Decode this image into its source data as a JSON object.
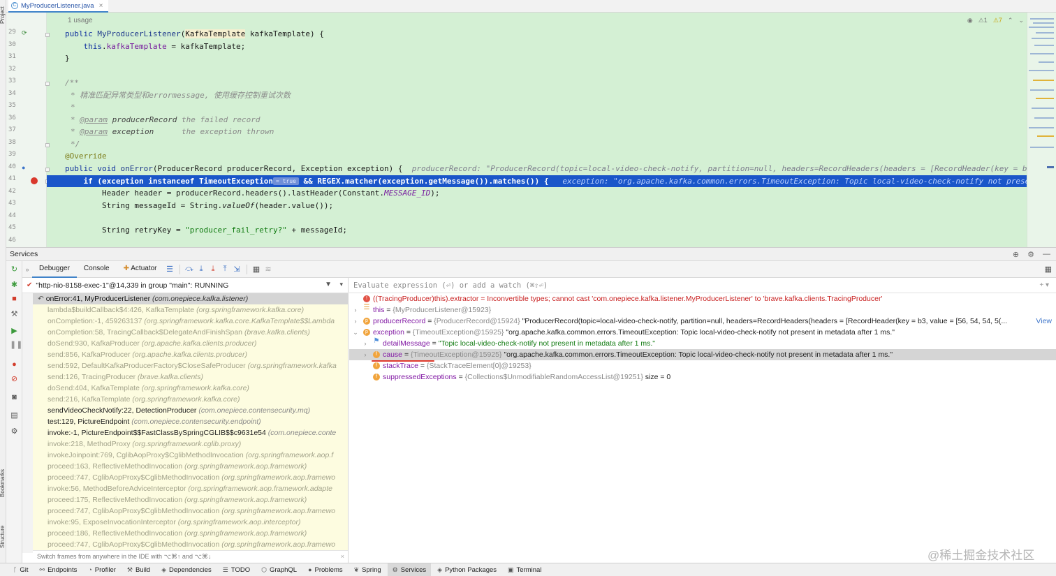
{
  "editor": {
    "tab_name": "MyProducerListener.java",
    "usage_hint": "1 usage",
    "status": {
      "warnings_a": "1",
      "warnings_b": "7"
    },
    "line_numbers": [
      "29",
      "30",
      "31",
      "32",
      "33",
      "34",
      "35",
      "36",
      "37",
      "38",
      "39",
      "40",
      "41",
      "42",
      "43",
      "44",
      "45",
      "46"
    ],
    "lines": {
      "l29": {
        "kw": "public",
        "name": "MyProducerListener",
        "paren": "(",
        "type": "KafkaTemplate",
        "rest": " kafkaTemplate) {"
      },
      "l30": {
        "kw": "this",
        "dot": ".",
        "field": "kafkaTemplate",
        "rest": " = kafkaTemplate;"
      },
      "l31": "}",
      "l33": "/**",
      "l34": "* 精准匹配异常类型和errormessage, 使用缓存控制重试次数",
      "l35": "*",
      "l36": {
        "star": "* ",
        "tag": "@param",
        "param": " producerRecord",
        "desc": " the failed record"
      },
      "l37": {
        "star": "* ",
        "tag": "@param",
        "param": " exception",
        "desc": "      the exception thrown"
      },
      "l38": "*/",
      "l39": "@Override",
      "l40": {
        "kw": "public void",
        "name": " onError",
        "rest": "(ProducerRecord producerRecord, Exception exception) {",
        "inlay": "  producerRecord: \"ProducerRecord(topic=local-video-check-notify, partition=null, headers=RecordHeaders(headers = [RecordHeader(key = b3, value"
      },
      "l41": {
        "code": "    if (exception instanceof TimeoutException",
        "pill": "= true",
        "code2": " && REGEX.matcher(exception.getMessage()).matches()) {",
        "inlay": "   exception: \"org.apache.kafka.common.errors.TimeoutException: Topic local-video-check-notify not present in"
      },
      "l42": {
        "pre": "        Header header = producerRecord.headers().lastHeader(Constant.",
        "const": "MESSAGE_ID",
        "post": ");"
      },
      "l43": {
        "pre": "        String messageId = String.",
        "method": "valueOf",
        "post": "(header.value());"
      },
      "l45": {
        "pre": "        String retryKey = ",
        "str": "\"producer_fail_retry?\"",
        "post": " + messageId;"
      }
    }
  },
  "services": {
    "title": "Services",
    "tabs": [
      "Debugger",
      "Console",
      "Actuator"
    ]
  },
  "thread": {
    "label": "\"http-nio-8158-exec-1\"@14,339 in group \"main\": RUNNING"
  },
  "frames": [
    {
      "m": "onError:41, MyProducerListener",
      "p": "(com.onepiece.kafka.listener)",
      "kind": "sel"
    },
    {
      "m": "lambda$buildCallback$4:426, KafkaTemplate",
      "p": "(org.springframework.kafka.core)",
      "kind": "lib"
    },
    {
      "m": "onCompletion:-1, 459263137",
      "p": "(org.springframework.kafka.core.KafkaTemplate$$Lambda",
      "kind": "lib"
    },
    {
      "m": "onCompletion:58, TracingCallback$DelegateAndFinishSpan",
      "p": "(brave.kafka.clients)",
      "kind": "lib"
    },
    {
      "m": "doSend:930, KafkaProducer",
      "p": "(org.apache.kafka.clients.producer)",
      "kind": "lib"
    },
    {
      "m": "send:856, KafkaProducer",
      "p": "(org.apache.kafka.clients.producer)",
      "kind": "lib"
    },
    {
      "m": "send:592, DefaultKafkaProducerFactory$CloseSafeProducer",
      "p": "(org.springframework.kafka",
      "kind": "lib"
    },
    {
      "m": "send:126, TracingProducer",
      "p": "(brave.kafka.clients)",
      "kind": "lib"
    },
    {
      "m": "doSend:404, KafkaTemplate",
      "p": "(org.springframework.kafka.core)",
      "kind": "lib"
    },
    {
      "m": "send:216, KafkaTemplate",
      "p": "(org.springframework.kafka.core)",
      "kind": "lib"
    },
    {
      "m": "sendVideoCheckNotify:22, DetectionProducer",
      "p": "(com.onepiece.contensecurity.mq)",
      "kind": "user"
    },
    {
      "m": "test:129, PictureEndpoint",
      "p": "(com.onepiece.contensecurity.endpoint)",
      "kind": "user"
    },
    {
      "m": "invoke:-1, PictureEndpoint$$FastClassBySpringCGLIB$$c9631e54",
      "p": "(com.onepiece.conte",
      "kind": "user"
    },
    {
      "m": "invoke:218, MethodProxy",
      "p": "(org.springframework.cglib.proxy)",
      "kind": "lib"
    },
    {
      "m": "invokeJoinpoint:769, CglibAopProxy$CglibMethodInvocation",
      "p": "(org.springframework.aop.f",
      "kind": "lib"
    },
    {
      "m": "proceed:163, ReflectiveMethodInvocation",
      "p": "(org.springframework.aop.framework)",
      "kind": "lib"
    },
    {
      "m": "proceed:747, CglibAopProxy$CglibMethodInvocation",
      "p": "(org.springframework.aop.framewo",
      "kind": "lib"
    },
    {
      "m": "invoke:56, MethodBeforeAdviceInterceptor",
      "p": "(org.springframework.aop.framework.adapte",
      "kind": "lib"
    },
    {
      "m": "proceed:175, ReflectiveMethodInvocation",
      "p": "(org.springframework.aop.framework)",
      "kind": "lib"
    },
    {
      "m": "proceed:747, CglibAopProxy$CglibMethodInvocation",
      "p": "(org.springframework.aop.framewo",
      "kind": "lib"
    },
    {
      "m": "invoke:95, ExposeInvocationInterceptor",
      "p": "(org.springframework.aop.interceptor)",
      "kind": "lib"
    },
    {
      "m": "proceed:186, ReflectiveMethodInvocation",
      "p": "(org.springframework.aop.framework)",
      "kind": "lib"
    },
    {
      "m": "proceed:747, CglibAopProxy$CglibMethodInvocation",
      "p": "(org.springframework.aop.framewo",
      "kind": "lib"
    }
  ],
  "frames_hint": "Switch frames from anywhere in the IDE with ⌥⌘↑ and ⌥⌘↓",
  "eval_placeholder": "Evaluate expression (⏎) or add a watch (⌘⇧⏎)",
  "variables": {
    "err": {
      "expr": "((TracingProducer)this).extractor",
      "eq": " = ",
      "msg": "Inconvertible types; cannot cast 'com.onepiece.kafka.listener.MyProducerListener' to 'brave.kafka.clients.TracingProducer'"
    },
    "this": {
      "name": "this",
      "eq": " = ",
      "type": "{MyProducerListener@15923}"
    },
    "record": {
      "name": "producerRecord",
      "eq": " = ",
      "type": "{ProducerRecord@15924}",
      "value": " \"ProducerRecord(topic=local-video-check-notify, partition=null, headers=RecordHeaders(headers = [RecordHeader(key = b3, value = [56, 54, 54, 5(...",
      "link": "View"
    },
    "exception": {
      "name": "exception",
      "eq": " = ",
      "type": "{TimeoutException@15925}",
      "value": " \"org.apache.kafka.common.errors.TimeoutException: Topic local-video-check-notify not present in metadata after 1 ms.\""
    },
    "detail": {
      "name": "detailMessage",
      "eq": " = ",
      "value": "\"Topic local-video-check-notify not present in metadata after 1 ms.\""
    },
    "cause": {
      "name": "cause",
      "eq": " = ",
      "type": "{TimeoutException@15925}",
      "value": " \"org.apache.kafka.common.errors.TimeoutException: Topic local-video-check-notify not present in metadata after 1 ms.\""
    },
    "stack": {
      "name": "stackTrace",
      "eq": " = ",
      "type": "{StackTraceElement[0]@19253}"
    },
    "suppressed": {
      "name": "suppressedExceptions",
      "eq": " = ",
      "type": "{Collections$UnmodifiableRandomAccessList@19251}",
      "value": "  size = 0"
    }
  },
  "bottom_tabs": [
    "Git",
    "Endpoints",
    "Profiler",
    "Build",
    "Dependencies",
    "TODO",
    "GraphQL",
    "Problems",
    "Spring",
    "Services",
    "Python Packages",
    "Terminal"
  ],
  "active_bottom_tab": "Services",
  "left_labels": {
    "project": "Project",
    "bookmarks": "Bookmarks",
    "structure": "Structure"
  },
  "watermark": "@稀土掘金技术社区",
  "colors": {
    "accent": "#4083c9",
    "editor_bg": "#d4f0d4",
    "highlight": "#1a56c9",
    "frames_bg": "#fdfce0",
    "breakpoint": "#d9382c"
  }
}
